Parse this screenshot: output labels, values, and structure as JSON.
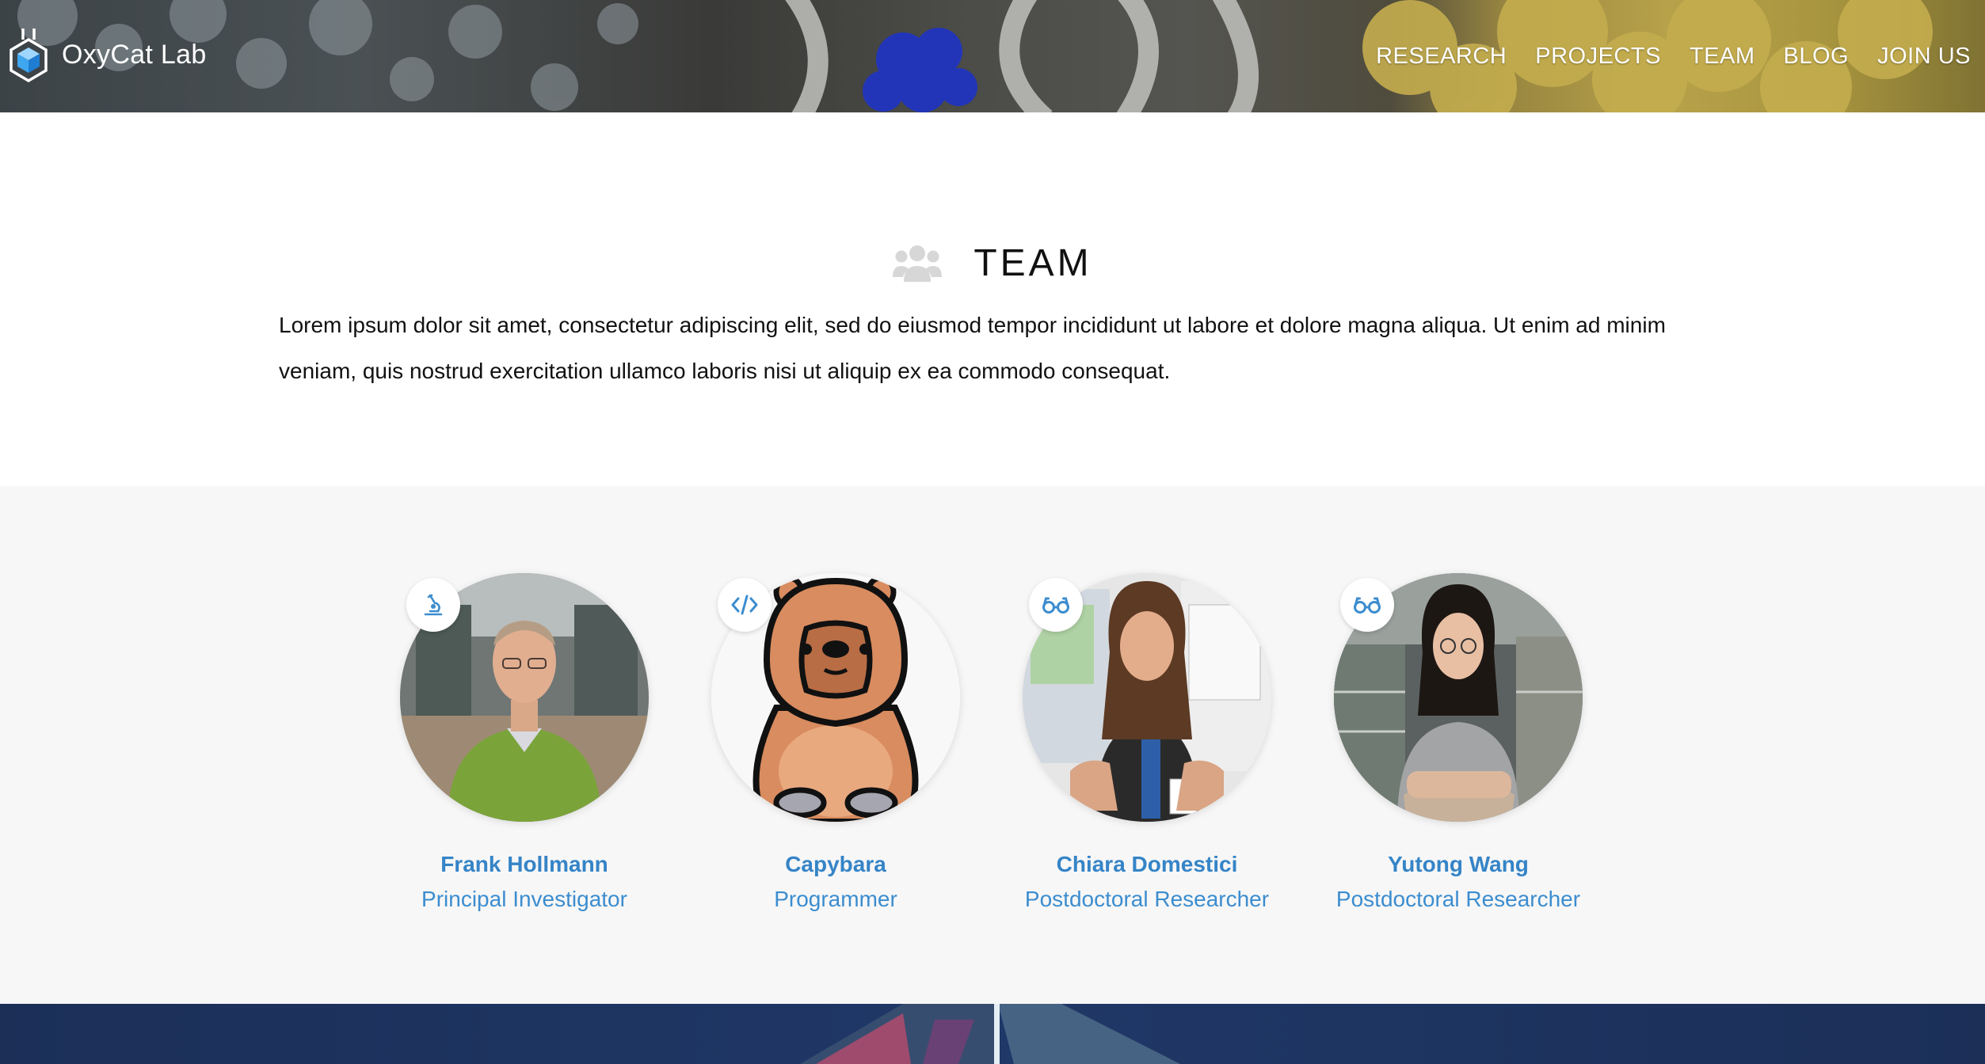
{
  "header": {
    "brand": "OxyCat Lab",
    "nav": [
      "RESEARCH",
      "PROJECTS",
      "TEAM",
      "BLOG",
      "JOIN US"
    ]
  },
  "intro": {
    "title": "TEAM",
    "title_icon": "users-icon",
    "text": "Lorem ipsum dolor sit amet, consectetur adipiscing elit, sed do eiusmod tempor incididunt ut labore et dolore magna aliqua. Ut enim ad minim veniam, quis nostrud exercitation ullamco laboris nisi ut aliquip ex ea commodo consequat."
  },
  "team": {
    "members": [
      {
        "name": "Frank Hollmann",
        "role": "Principal Investigator",
        "badge_icon": "microscope-icon"
      },
      {
        "name": "Capybara",
        "role": "Programmer",
        "badge_icon": "code-icon"
      },
      {
        "name": "Chiara Domestici",
        "role": "Postdoctoral Researcher",
        "badge_icon": "glasses-icon"
      },
      {
        "name": "Yutong Wang",
        "role": "Postdoctoral Researcher",
        "badge_icon": "glasses-icon"
      }
    ]
  },
  "colors": {
    "accent": "#3584c7",
    "section_bg": "#f7f7f7",
    "footer_bg": "#1f3564",
    "protein_yellow": "#b7a24a",
    "protein_blue": "#2235b8"
  }
}
